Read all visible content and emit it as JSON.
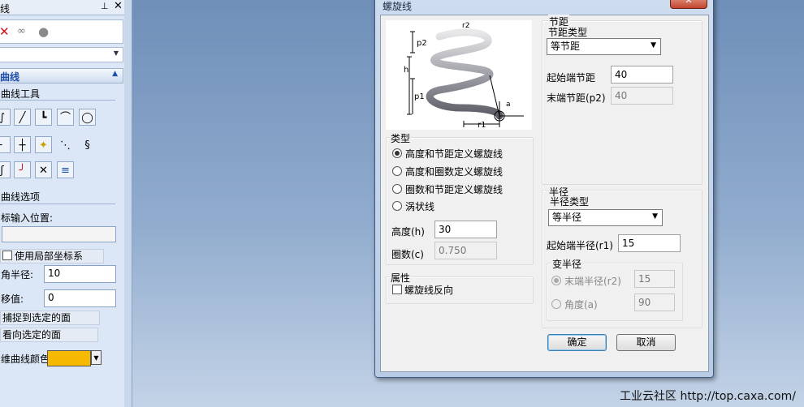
{
  "side": {
    "title": "线",
    "pin_icon": "pin-icon",
    "close_icon": "close-icon",
    "toolbar_icons": [
      "red-x-icon",
      "glasses-icon",
      "gray-circle-icon"
    ],
    "section_title": "曲线",
    "tools_heading": "曲线工具",
    "tool_icons_row1": [
      "spline-icon",
      "line-icon",
      "polyline-icon",
      "arc-icon",
      "circle-icon"
    ],
    "tool_icons_row2": [
      "tangent-line-icon",
      "point-icon",
      "intersection-point-icon",
      "dotted-line-icon",
      "helix-icon"
    ],
    "tool_icons_row3": [
      "curve-icon",
      "fillet-curve-icon",
      "cross-icon",
      "offset-icon"
    ],
    "options_heading": "曲线选项",
    "coord_input_label": "标输入位置:",
    "use_local_coords": "使用局部坐标系",
    "radius_label": "角半径:",
    "radius_value": "10",
    "offset_label": "移值:",
    "offset_value": "0",
    "snap_face_label": "捕捉到选定的面",
    "view_face_label": "看向选定的面",
    "color_label": "维曲线颜色",
    "color_value": "#f7b800"
  },
  "dialog": {
    "title": "螺旋线",
    "close_icon": "close-icon",
    "figure_icon": "helix-diagram-icon",
    "figure_labels": {
      "r2": "r2",
      "p2": "p2",
      "h": "h",
      "p1": "p1",
      "a": "a",
      "r1": "r1"
    },
    "type_group": {
      "label": "类型",
      "options": [
        "高度和节距定义螺旋线",
        "高度和圈数定义螺旋线",
        "圈数和节距定义螺旋线",
        "涡状线"
      ],
      "selected": 0
    },
    "height_label": "高度(h)",
    "height_value": "30",
    "turns_label": "圈数(c)",
    "turns_value": "0.750",
    "attr_group": {
      "label": "属性",
      "reverse_label": "螺旋线反向"
    },
    "pitch_group": {
      "label": "节距",
      "type_label": "节距类型",
      "type_value": "等节距",
      "start_label": "起始端节距",
      "start_value": "40",
      "end_label": "末端节距(p2)",
      "end_value": "40"
    },
    "radius_group": {
      "label": "半径",
      "type_label": "半径类型",
      "type_value": "等半径",
      "start_label": "起始端半径(r1)",
      "start_value": "15",
      "var_label": "变半径",
      "end_label": "末端半径(r2)",
      "end_value": "15",
      "angle_label": "角度(a)",
      "angle_value": "90"
    },
    "ok_label": "确定",
    "cancel_label": "取消"
  },
  "watermark": "工业云社区 http://top.caxa.com/"
}
